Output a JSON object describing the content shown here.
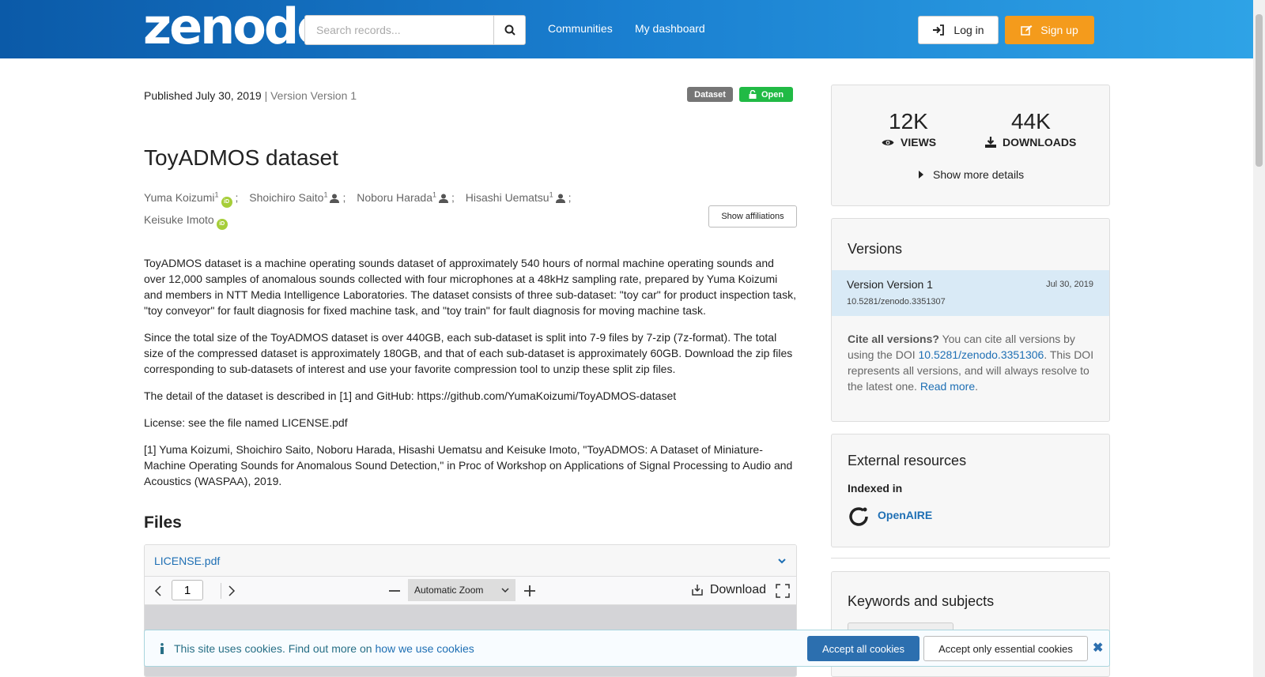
{
  "header": {
    "logo": "zenodo",
    "search_placeholder": "Search records...",
    "nav": [
      "Communities",
      "My dashboard"
    ],
    "login_label": "Log in",
    "signup_label": "Sign up"
  },
  "record": {
    "published": "Published July 30, 2019",
    "version_text": "| Version Version 1",
    "badge_type": "Dataset",
    "badge_access": "Open",
    "title": "ToyADMOS dataset",
    "authors": [
      {
        "name": "Yuma Koizumi",
        "sup": "1",
        "icon": "orcid-icon",
        "sep": ";"
      },
      {
        "name": "Shoichiro Saito",
        "sup": "1",
        "icon": "person-icon",
        "sep": ";"
      },
      {
        "name": "Noboru Harada",
        "sup": "1",
        "icon": "person-icon",
        "sep": ";"
      },
      {
        "name": "Hisashi Uematsu",
        "sup": "1",
        "icon": "person-icon",
        "sep": ";"
      },
      {
        "name": "Keisuke Imoto",
        "sup": "",
        "icon": "orcid-icon",
        "sep": ""
      }
    ],
    "show_affiliations": "Show affiliations",
    "description": [
      "ToyADMOS dataset is a machine operating sounds dataset of approximately 540 hours of normal machine operating sounds and over 12,000 samples of anomalous sounds collected with four microphones at a 48kHz sampling rate, prepared by Yuma Koizumi and members in NTT Media Intelligence Laboratories. The dataset consists of three sub-dataset: \"toy car\" for product inspection task, \"toy conveyor\" for fault diagnosis for fixed machine task, and \"toy train\" for fault diagnosis for moving machine task.",
      "Since the total size of the ToyADMOS dataset is over 440GB, each sub-dataset is split into 7-9 files by 7-zip (7z-format). The total size of the compressed dataset is approximately 180GB, and that of each sub-dataset is approximately 60GB. Download the zip files corresponding to sub-datasets of interest and use your favorite compression tool to unzip these split zip files.",
      "The detail of the dataset is described in [1] and GitHub: https://github.com/YumaKoizumi/ToyADMOS-dataset",
      "License: see the file named LICENSE.pdf",
      "[1] Yuma Koizumi, Shoichiro Saito, Noboru Harada, Hisashi Uematsu and Keisuke Imoto, \"ToyADMOS: A Dataset of Miniature-Machine Operating Sounds for Anomalous Sound Detection,\" in Proc of Workshop on Applications of Signal Processing to Audio and Acoustics (WASPAA), 2019."
    ]
  },
  "files": {
    "title": "Files",
    "file_name": "LICENSE.pdf",
    "page_value": "1",
    "zoom": "Automatic Zoom",
    "download_label": "Download"
  },
  "sidebar": {
    "views_count": "12K",
    "views_label": "VIEWS",
    "downloads_count": "44K",
    "downloads_label": "DOWNLOADS",
    "more_details": "Show more details",
    "versions_title": "Versions",
    "version_name": "Version Version 1",
    "version_date": "Jul 30, 2019",
    "version_doi": "10.5281/zenodo.3351307",
    "cite_bold": "Cite all versions?",
    "cite_text_1": " You can cite all versions by using the DOI ",
    "cite_doi": "10.5281/zenodo.3351306",
    "cite_text_2": ". This DOI represents all versions, and will always resolve to the latest one. ",
    "read_more": "Read more",
    "external_title": "External resources",
    "indexed_in": "Indexed in",
    "openaire": "OpenAIRE",
    "keywords_title": "Keywords and subjects"
  },
  "cookie": {
    "text": "This site uses cookies. Find out more on ",
    "link": "how we use cookies",
    "accept_all": "Accept all cookies",
    "accept_essential": "Accept only essential cookies"
  }
}
